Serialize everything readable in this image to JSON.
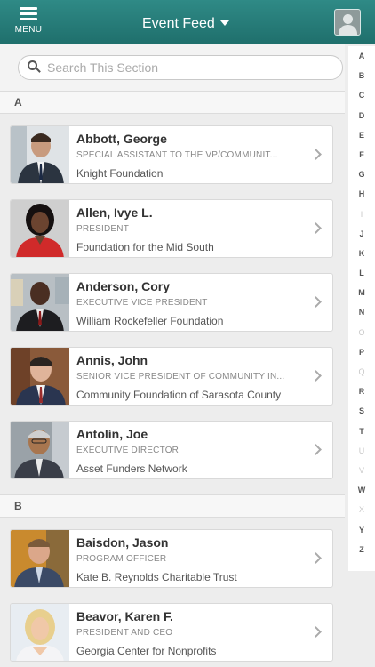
{
  "header": {
    "menu_label": "MENU",
    "title": "Event Feed"
  },
  "search": {
    "placeholder": "Search This Section"
  },
  "sections": [
    {
      "letter": "A",
      "people": [
        {
          "name": "Abbott, George",
          "title": "SPECIAL ASSISTANT TO THE VP/COMMUNIT...",
          "org": "Knight Foundation"
        },
        {
          "name": "Allen, Ivye L.",
          "title": "PRESIDENT",
          "org": "Foundation for the Mid South"
        },
        {
          "name": "Anderson, Cory",
          "title": "EXECUTIVE VICE PRESIDENT",
          "org": "William Rockefeller Foundation"
        },
        {
          "name": "Annis, John",
          "title": "SENIOR VICE PRESIDENT OF COMMUNITY IN...",
          "org": "Community Foundation of Sarasota County"
        },
        {
          "name": "Antolín, Joe",
          "title": "EXECUTIVE DIRECTOR",
          "org": "Asset Funders Network"
        }
      ]
    },
    {
      "letter": "B",
      "people": [
        {
          "name": "Baisdon, Jason",
          "title": "PROGRAM OFFICER",
          "org": "Kate B. Reynolds Charitable Trust"
        },
        {
          "name": "Beavor, Karen F.",
          "title": "PRESIDENT AND CEO",
          "org": "Georgia Center for Nonprofits"
        }
      ]
    }
  ],
  "index": [
    {
      "l": "A",
      "active": true
    },
    {
      "l": "B",
      "active": true
    },
    {
      "l": "C",
      "active": true
    },
    {
      "l": "D",
      "active": true
    },
    {
      "l": "E",
      "active": true
    },
    {
      "l": "F",
      "active": true
    },
    {
      "l": "G",
      "active": true
    },
    {
      "l": "H",
      "active": true
    },
    {
      "l": "I",
      "active": false
    },
    {
      "l": "J",
      "active": true
    },
    {
      "l": "K",
      "active": true
    },
    {
      "l": "L",
      "active": true
    },
    {
      "l": "M",
      "active": true
    },
    {
      "l": "N",
      "active": true
    },
    {
      "l": "O",
      "active": false
    },
    {
      "l": "P",
      "active": true
    },
    {
      "l": "Q",
      "active": false
    },
    {
      "l": "R",
      "active": true
    },
    {
      "l": "S",
      "active": true
    },
    {
      "l": "T",
      "active": true
    },
    {
      "l": "U",
      "active": false
    },
    {
      "l": "V",
      "active": false
    },
    {
      "l": "W",
      "active": true
    },
    {
      "l": "X",
      "active": false
    },
    {
      "l": "Y",
      "active": true
    },
    {
      "l": "Z",
      "active": true
    }
  ],
  "colors": {
    "header": "#22736f",
    "accent": "#2f8a86"
  }
}
